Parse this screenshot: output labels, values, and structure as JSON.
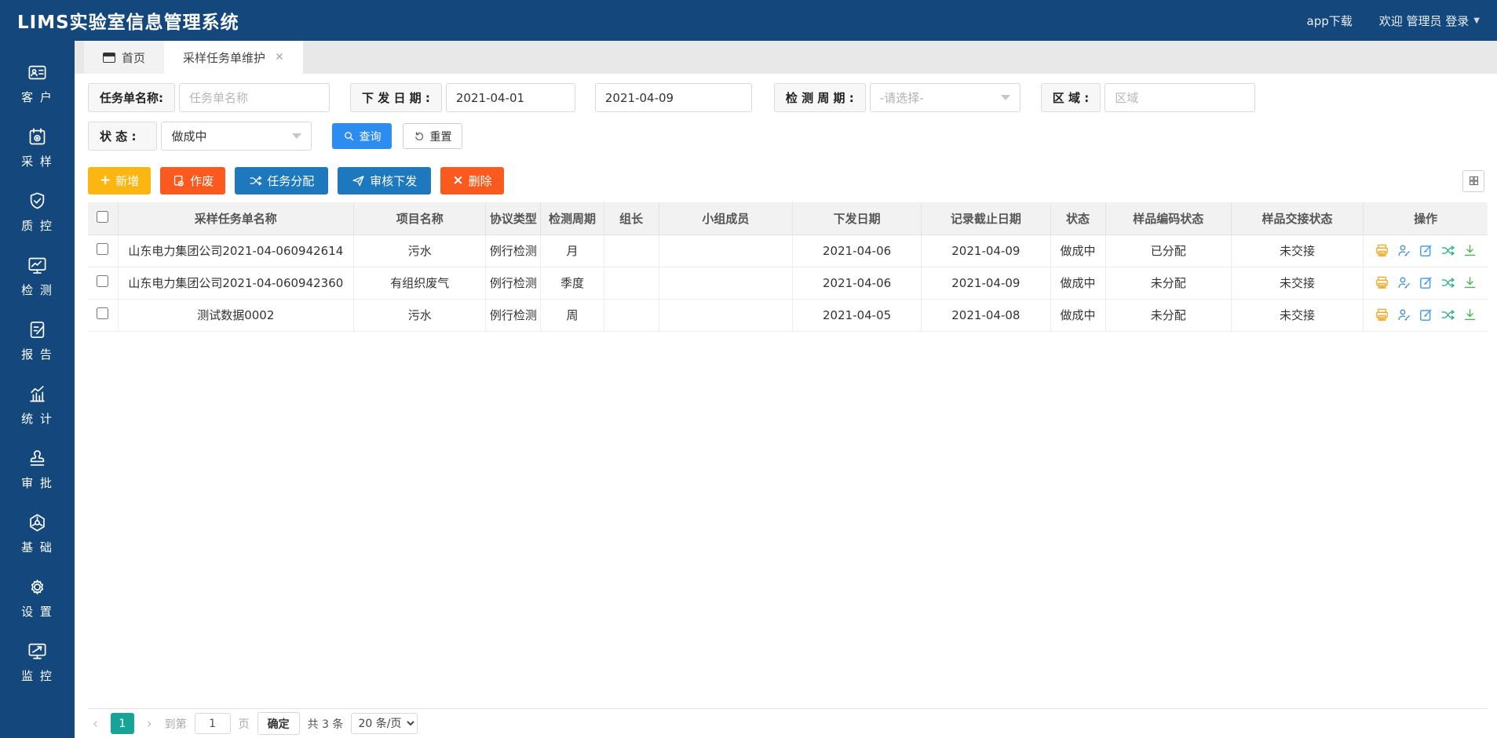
{
  "header": {
    "title": "LIMS实验室信息管理系统",
    "app_download": "app下载",
    "welcome": "欢迎 管理员 登录"
  },
  "sidebar": {
    "items": [
      {
        "label": "客 户",
        "icon": "id-card-icon"
      },
      {
        "label": "采 样",
        "icon": "calendar-gear-icon"
      },
      {
        "label": "质 控",
        "icon": "shield-check-icon"
      },
      {
        "label": "检 测",
        "icon": "monitor-chart-icon"
      },
      {
        "label": "报 告",
        "icon": "document-pencil-icon"
      },
      {
        "label": "统 计",
        "icon": "bar-chart-icon"
      },
      {
        "label": "审 批",
        "icon": "stamp-icon"
      },
      {
        "label": "基 础",
        "icon": "cube-icon"
      },
      {
        "label": "设 置",
        "icon": "gear-icon"
      },
      {
        "label": "监 控",
        "icon": "monitor-arrow-icon"
      }
    ]
  },
  "tabs": [
    {
      "label": "首页",
      "active": false
    },
    {
      "label": "采样任务单维护",
      "active": true,
      "closable": true
    }
  ],
  "filters": {
    "task_name_label": "任务单名称:",
    "task_name_placeholder": "任务单名称",
    "issue_date_label": "下 发 日 期 :",
    "issue_date_from": "2021-04-01",
    "issue_date_to": "2021-04-09",
    "test_cycle_label": "检 测 周 期 :",
    "test_cycle_value": "-请选择-",
    "region_label": "区  域  :",
    "region_placeholder": "区域",
    "status_label": "状  态  :",
    "status_value": "做成中",
    "search_label": "查询",
    "reset_label": "重置"
  },
  "toolbar": {
    "add": "新增",
    "void": "作废",
    "assign": "任务分配",
    "review": "审核下发",
    "delete": "删除"
  },
  "table": {
    "columns": [
      "采样任务单名称",
      "项目名称",
      "协议类型",
      "检测周期",
      "组长",
      "小组成员",
      "下发日期",
      "记录截止日期",
      "状态",
      "样品编码状态",
      "样品交接状态",
      "操作"
    ],
    "rows": [
      {
        "name": "山东电力集团公司2021-04-060942614",
        "project": "污水",
        "protocol": "例行检测",
        "cycle": "月",
        "leader": "",
        "members": "",
        "issue_date": "2021-04-06",
        "deadline": "2021-04-09",
        "status": "做成中",
        "code_status": "已分配",
        "handover_status": "未交接"
      },
      {
        "name": "山东电力集团公司2021-04-060942360",
        "project": "有组织废气",
        "protocol": "例行检测",
        "cycle": "季度",
        "leader": "",
        "members": "",
        "issue_date": "2021-04-06",
        "deadline": "2021-04-09",
        "status": "做成中",
        "code_status": "未分配",
        "handover_status": "未交接"
      },
      {
        "name": "测试数据0002",
        "project": "污水",
        "protocol": "例行检测",
        "cycle": "周",
        "leader": "",
        "members": "",
        "issue_date": "2021-04-05",
        "deadline": "2021-04-08",
        "status": "做成中",
        "code_status": "未分配",
        "handover_status": "未交接"
      }
    ]
  },
  "pagination": {
    "current_page": "1",
    "goto_label": "到第",
    "page_input_value": "1",
    "page_unit_label": "页",
    "confirm_label": "确定",
    "total_label": "共 3 条",
    "page_size_label": "20 条/页"
  },
  "colors": {
    "navy": "#14487c",
    "primary_blue": "#2d8cf0",
    "toolbar_blue": "#1e78be",
    "amber": "#fbb612",
    "red_orange": "#fa5a1e",
    "teal": "#17a398"
  }
}
